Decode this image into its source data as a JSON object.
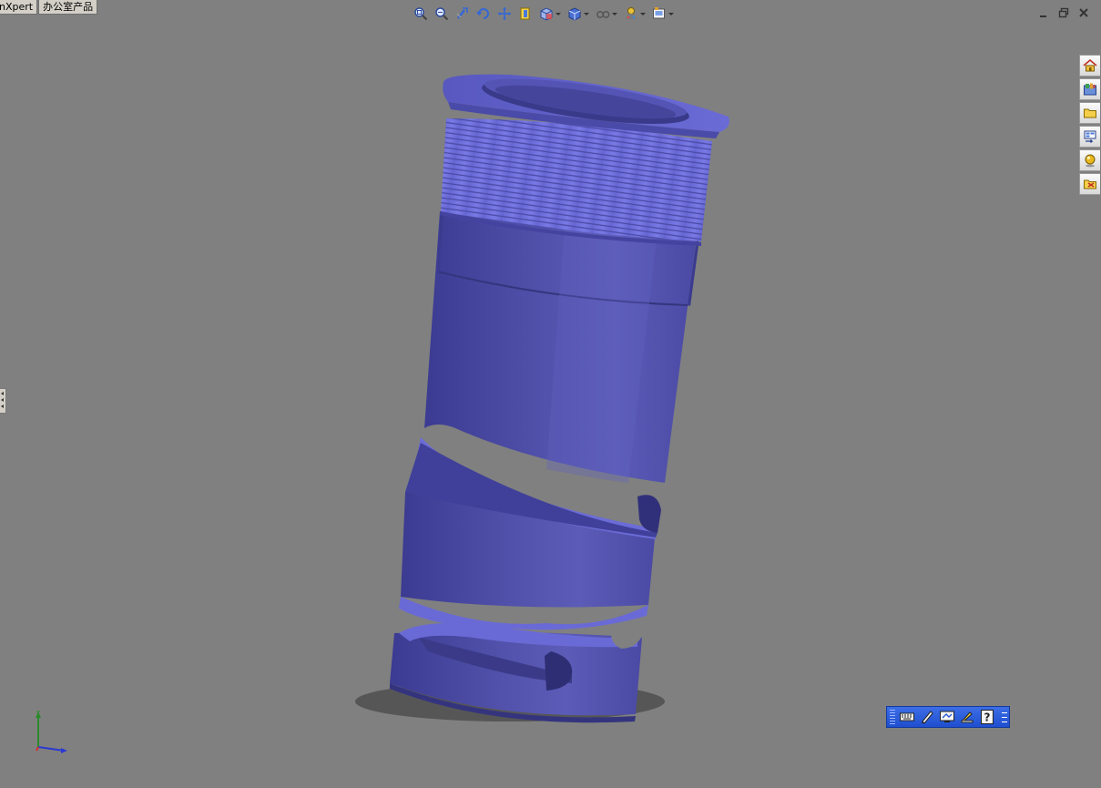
{
  "tabs": [
    {
      "label": "nXpert"
    },
    {
      "label": "办公室产品"
    }
  ],
  "hud_toolbar": {
    "icons": [
      "zoom-to-fit-icon",
      "zoom-to-area-icon",
      "previous-view-icon",
      "rotate-view-icon",
      "pan-icon",
      "section-view-icon",
      "view-orientation-icon",
      "display-style-icon",
      "hide-show-items-icon",
      "edit-appearance-icon",
      "apply-scene-icon"
    ]
  },
  "window_controls": [
    "minimize-icon",
    "restore-icon",
    "close-icon"
  ],
  "task_pane": {
    "icons": [
      "solidworks-resources-icon",
      "design-library-icon",
      "file-explorer-icon",
      "view-palette-icon",
      "appearances-icon",
      "custom-properties-icon"
    ]
  },
  "float_toolbar": {
    "icons": [
      "keyboard-icon",
      "sketch-pen-icon",
      "screen-capture-icon",
      "measure-icon",
      "help-icon"
    ]
  },
  "colors": {
    "background": "#808080",
    "part": "#5a5ab8",
    "part_light": "#7a7ae0",
    "part_dark": "#3e3e8c",
    "toolbar_blue": "#2a5bd7"
  }
}
